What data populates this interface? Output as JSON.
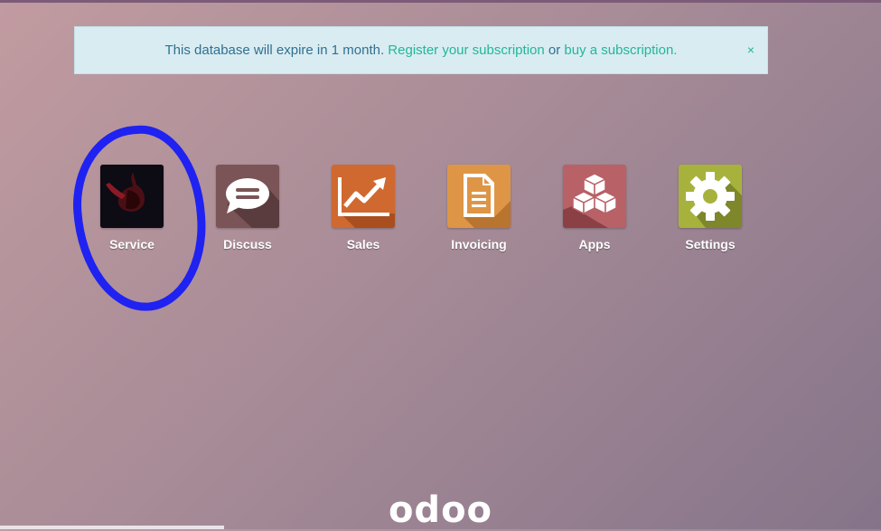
{
  "notice": {
    "text_before": "This database will expire in 1 month. ",
    "register_link": "Register your subscription",
    "middle": " or ",
    "buy_link": "buy a subscription.",
    "close": "×"
  },
  "apps": [
    {
      "label": "Service",
      "icon": "service-icon",
      "color": "#0d0b14"
    },
    {
      "label": "Discuss",
      "icon": "chat-bubble-icon",
      "color": "#7a5456"
    },
    {
      "label": "Sales",
      "icon": "trend-chart-icon",
      "color": "#d0692f"
    },
    {
      "label": "Invoicing",
      "icon": "document-icon",
      "color": "#de9646"
    },
    {
      "label": "Apps",
      "icon": "cubes-icon",
      "color": "#b86166"
    },
    {
      "label": "Settings",
      "icon": "gear-icon",
      "color": "#a7b23d"
    }
  ],
  "logo": "odoo",
  "colors": {
    "link": "#21b799",
    "notice_bg": "#d9ecf2",
    "annotation_circle": "#1f22f0"
  }
}
